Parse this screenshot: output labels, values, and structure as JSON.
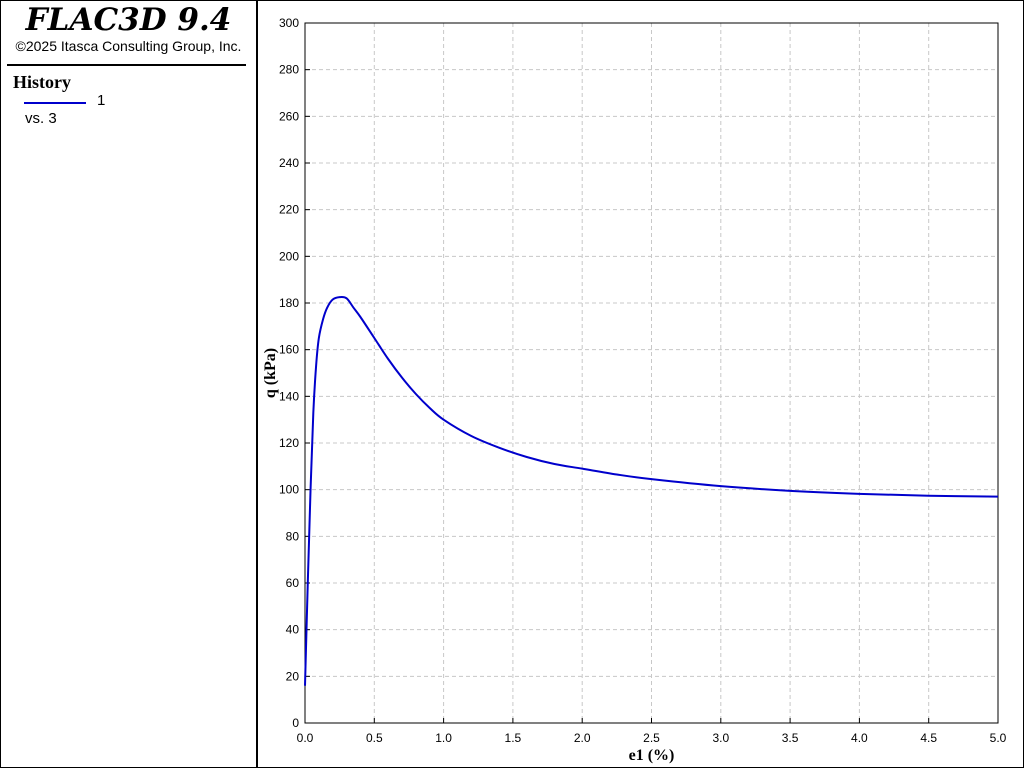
{
  "app": {
    "title": "FLAC3D 9.4",
    "copyright": "©2025 Itasca Consulting Group, Inc."
  },
  "legend": {
    "heading": "History",
    "series_name": "1",
    "vs_label": "vs. 3",
    "line_color": "#0000cc"
  },
  "chart_data": {
    "type": "line",
    "xlabel": "e1 (%)",
    "ylabel": "q (kPa)",
    "xlim": [
      0,
      5
    ],
    "ylim": [
      0,
      300
    ],
    "xticks": [
      0,
      0.5,
      1,
      1.5,
      2,
      2.5,
      3,
      3.5,
      4,
      4.5,
      5
    ],
    "yticks": [
      0,
      20,
      40,
      60,
      80,
      100,
      120,
      140,
      160,
      180,
      200,
      220,
      240,
      260,
      280,
      300
    ],
    "xtick_labels": [
      "0.0",
      "0.5",
      "1.0",
      "1.5",
      "2.0",
      "2.5",
      "3.0",
      "3.5",
      "4.0",
      "4.5",
      "5.0"
    ],
    "ytick_labels": [
      "0",
      "20",
      "40",
      "60",
      "80",
      "100",
      "120",
      "140",
      "160",
      "180",
      "200",
      "220",
      "240",
      "260",
      "280",
      "300"
    ],
    "grid": true,
    "series": [
      {
        "name": "1",
        "color": "#0000cc",
        "x": [
          0,
          0.02,
          0.04,
          0.06,
          0.08,
          0.1,
          0.13,
          0.16,
          0.2,
          0.25,
          0.3,
          0.35,
          0.4,
          0.5,
          0.6,
          0.7,
          0.8,
          0.9,
          1.0,
          1.2,
          1.4,
          1.6,
          1.8,
          2.0,
          2.25,
          2.5,
          3.0,
          3.5,
          4.0,
          4.5,
          5.0
        ],
        "y": [
          16,
          60,
          100,
          133,
          153,
          165,
          173,
          178,
          181.5,
          182.5,
          182,
          178,
          174,
          165,
          156,
          148,
          141,
          135,
          130,
          123,
          118,
          114,
          111,
          109,
          106.5,
          104.5,
          101.5,
          99.5,
          98.2,
          97.4,
          97
        ]
      }
    ]
  }
}
